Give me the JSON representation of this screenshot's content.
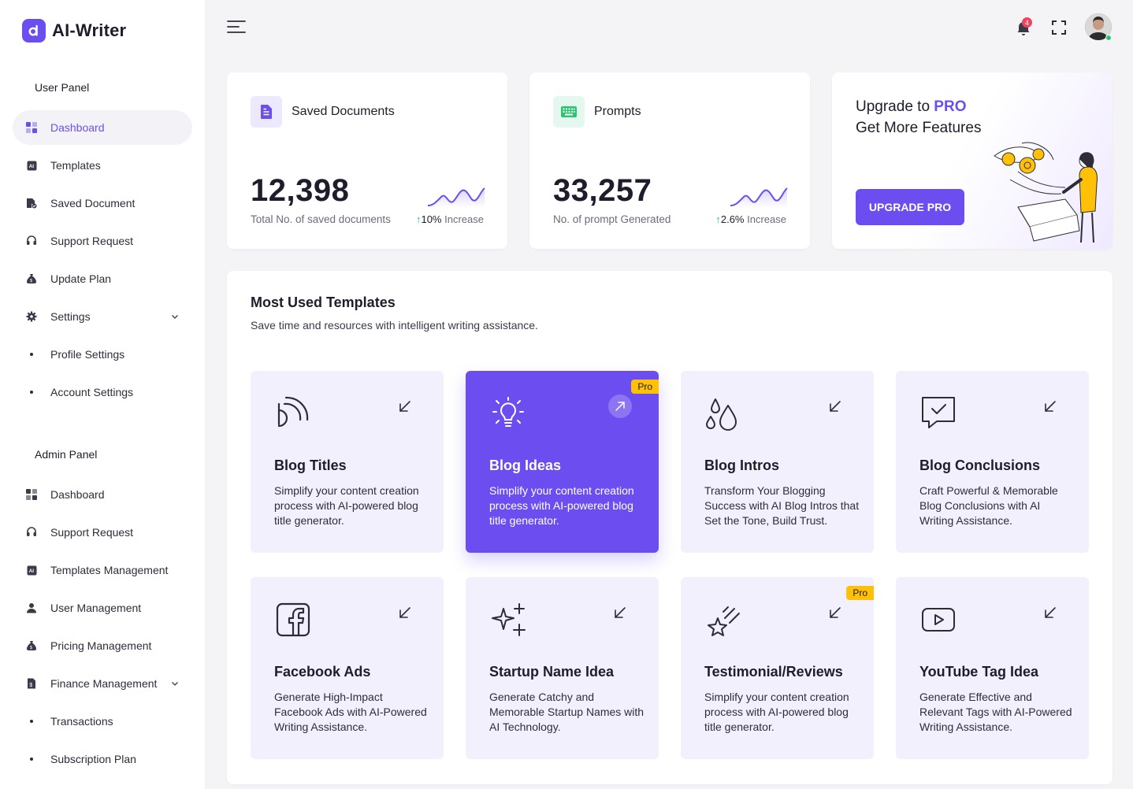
{
  "brand": {
    "name": "AI-Writer",
    "logo_letter": "a"
  },
  "colors": {
    "accent": "#6c4ef0",
    "pro_badge": "#ffc107",
    "increase": "#28c76f",
    "notification": "#f0445e"
  },
  "sidebar": {
    "user_panel_title": "User Panel",
    "user_items": [
      {
        "label": "Dashboard",
        "icon": "dashboard-grid-icon",
        "active": true
      },
      {
        "label": "Templates",
        "icon": "ai-chip-icon"
      },
      {
        "label": "Saved Document",
        "icon": "document-check-icon"
      },
      {
        "label": "Support Request",
        "icon": "headset-icon"
      },
      {
        "label": "Update Plan",
        "icon": "money-bag-icon"
      },
      {
        "label": "Settings",
        "icon": "gear-icon",
        "expanded": true
      },
      {
        "label": "Profile Settings",
        "sub": true
      },
      {
        "label": "Account Settings",
        "sub": true
      }
    ],
    "admin_panel_title": "Admin Panel",
    "admin_items": [
      {
        "label": "Dashboard",
        "icon": "dashboard-grid-icon"
      },
      {
        "label": "Support Request",
        "icon": "headset-icon"
      },
      {
        "label": "Templates Management",
        "icon": "ai-chip-icon"
      },
      {
        "label": "User Management",
        "icon": "user-icon"
      },
      {
        "label": "Pricing Management",
        "icon": "money-bag-icon"
      },
      {
        "label": "Finance Management",
        "icon": "invoice-icon",
        "expanded": true
      },
      {
        "label": "Transactions",
        "sub": true
      },
      {
        "label": "Subscription Plan",
        "sub": true
      }
    ]
  },
  "topbar": {
    "notification_count": "4"
  },
  "stats": [
    {
      "title": "Saved Documents",
      "value": "12,398",
      "subtitle": "Total No. of saved documents",
      "increase": "10%",
      "increase_label": "Increase",
      "icon": "document-icon"
    },
    {
      "title": "Prompts",
      "value": "33,257",
      "subtitle": "No. of prompt Generated",
      "increase": "2.6%",
      "increase_label": "Increase",
      "icon": "keyboard-icon"
    }
  ],
  "promo": {
    "line1_prefix": "Upgrade to ",
    "line1_highlight": "PRO",
    "line2": "Get More Features",
    "button": "UPGRADE PRO"
  },
  "templates_section": {
    "title": "Most Used Templates",
    "subtitle": "Save time and resources with intelligent writing assistance.",
    "items": [
      {
        "name": "Blog Titles",
        "desc": "Simplify your content creation process with AI-powered blog title generator.",
        "icon": "broadcast-icon",
        "pro": false
      },
      {
        "name": "Blog Ideas",
        "desc": "Simplify your content creation process with AI-powered blog title generator.",
        "icon": "lightbulb-icon",
        "pro": true,
        "active": true
      },
      {
        "name": "Blog Intros",
        "desc": "Transform Your Blogging Success with AI Blog Intros that Set the Tone, Build Trust.",
        "icon": "droplets-icon",
        "pro": false
      },
      {
        "name": "Blog Conclusions",
        "desc": "Craft Powerful & Memorable Blog Conclusions with AI Writing Assistance.",
        "icon": "message-check-icon",
        "pro": false
      },
      {
        "name": "Facebook Ads",
        "desc": "Generate High-Impact Facebook Ads with AI-Powered Writing Assistance.",
        "icon": "facebook-icon",
        "pro": false
      },
      {
        "name": "Startup Name Idea",
        "desc": "Generate Catchy and Memorable Startup Names with AI Technology.",
        "icon": "sparkles-icon",
        "pro": false
      },
      {
        "name": "Testimonial/Reviews",
        "desc": "Simplify your content creation process with AI-powered blog title generator.",
        "icon": "shooting-star-icon",
        "pro": true
      },
      {
        "name": "YouTube Tag Idea",
        "desc": "Generate Effective and Relevant Tags with AI-Powered Writing Assistance.",
        "icon": "video-play-icon",
        "pro": false
      }
    ],
    "pro_label": "Pro"
  }
}
